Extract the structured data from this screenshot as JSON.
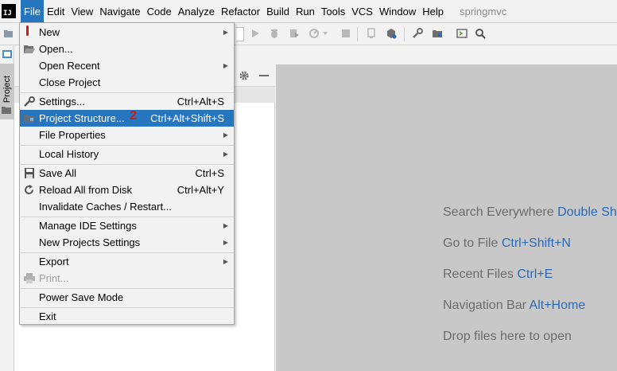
{
  "menubar": {
    "app_icon": "IJ",
    "items": [
      "File",
      "Edit",
      "View",
      "Navigate",
      "Code",
      "Analyze",
      "Refactor",
      "Build",
      "Run",
      "Tools",
      "VCS",
      "Window",
      "Help"
    ],
    "project_title": "springmvc"
  },
  "left_strip": {
    "project_tab": "Project"
  },
  "file_menu": {
    "new": "New",
    "open": "Open...",
    "open_recent": "Open Recent",
    "close_project": "Close Project",
    "settings": "Settings...",
    "settings_shortcut": "Ctrl+Alt+S",
    "project_structure": "Project Structure...",
    "project_structure_shortcut": "Ctrl+Alt+Shift+S",
    "file_properties": "File Properties",
    "local_history": "Local History",
    "save_all": "Save All",
    "save_all_shortcut": "Ctrl+S",
    "reload_all": "Reload All from Disk",
    "reload_all_shortcut": "Ctrl+Alt+Y",
    "invalidate_caches": "Invalidate Caches / Restart...",
    "manage_ide_settings": "Manage IDE Settings",
    "new_projects_settings": "New Projects Settings",
    "export": "Export",
    "print": "Print...",
    "power_save_mode": "Power Save Mode",
    "exit": "Exit"
  },
  "annotations": {
    "marker_2": "2"
  },
  "editor_hints": {
    "search_label": "Search Everywhere",
    "search_key": "Double Sh",
    "goto_file_label": "Go to File",
    "goto_file_key": "Ctrl+Shift+N",
    "recent_files_label": "Recent Files",
    "recent_files_key": "Ctrl+E",
    "nav_bar_label": "Navigation Bar",
    "nav_bar_key": "Alt+Home",
    "drop_files": "Drop files here to open"
  },
  "colors": {
    "menu_highlight": "#2675bf",
    "hint_key": "#2a68b8",
    "annotation_red": "#d01818",
    "editor_bg": "#c8c8c8"
  }
}
